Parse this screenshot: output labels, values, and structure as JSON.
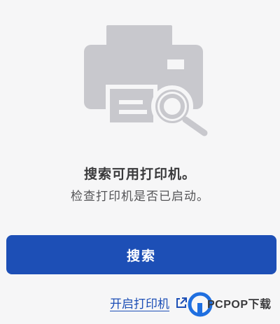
{
  "empty_state": {
    "title": "搜索可用打印机。",
    "subtitle": "检查打印机是否已启动。"
  },
  "actions": {
    "search_label": "搜索",
    "open_printer_label": "开启打印机"
  },
  "watermark": {
    "text": "PCPOP下载"
  },
  "colors": {
    "accent": "#1d4fb6",
    "illustration": "#c8c8cd",
    "background": "#f6f6f7"
  }
}
